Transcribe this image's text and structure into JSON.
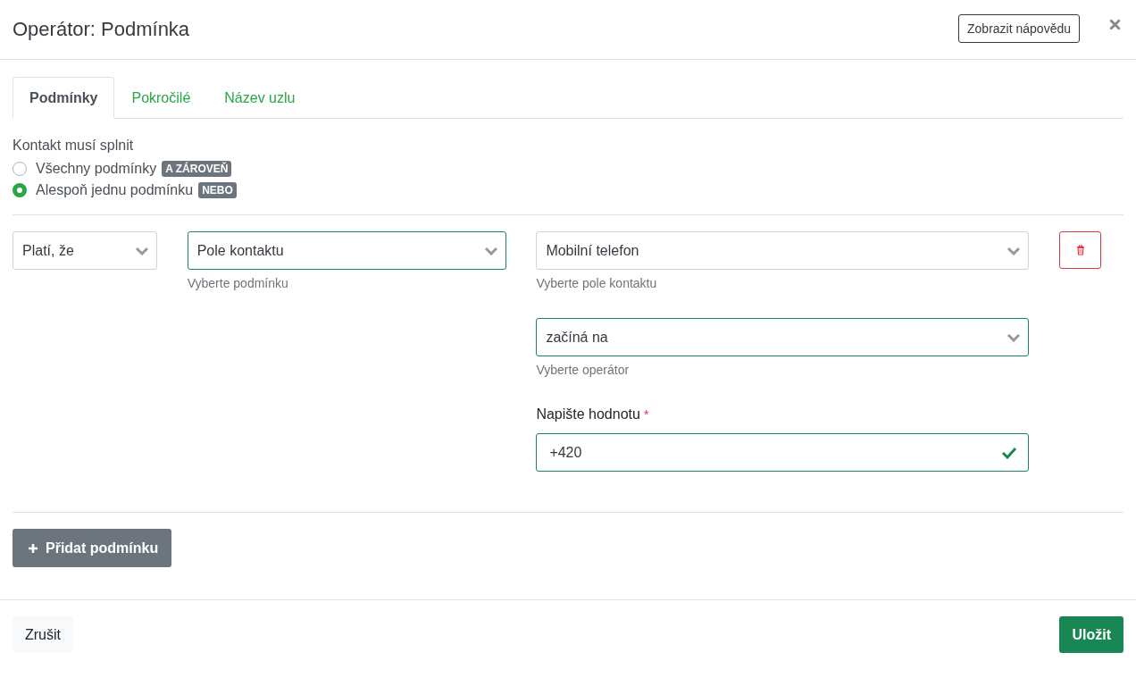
{
  "dialog": {
    "title": "Operátor: Podmínka",
    "help_button": "Zobrazit nápovědu"
  },
  "tabs": [
    {
      "label": "Podmínky",
      "selected": true
    },
    {
      "label": "Pokročilé",
      "selected": false
    },
    {
      "label": "Název uzlu",
      "selected": false
    }
  ],
  "match": {
    "label": "Kontakt musí splnit",
    "options": [
      {
        "label": "Všechny podmínky",
        "badge": "A ZÁROVEŇ",
        "selected": false
      },
      {
        "label": "Alespoň jednu podmínku",
        "badge": "NEBO",
        "selected": true
      }
    ]
  },
  "condition": {
    "negation": {
      "value": "Platí, že",
      "valid": false
    },
    "type": {
      "value": "Pole kontaktu",
      "hint": "Vyberte podmínku",
      "valid": true
    },
    "field": {
      "value": "Mobilní telefon",
      "hint": "Vyberte pole kontaktu",
      "valid": false
    },
    "operator": {
      "value": "začíná na",
      "hint": "Vyberte operátor",
      "valid": true
    },
    "value": {
      "label": "Napište hodnotu",
      "required_mark": "*",
      "value": "+420",
      "valid": true
    }
  },
  "add_button": "Přidat podmínku",
  "footer": {
    "cancel": "Zrušit",
    "save": "Uložit"
  }
}
